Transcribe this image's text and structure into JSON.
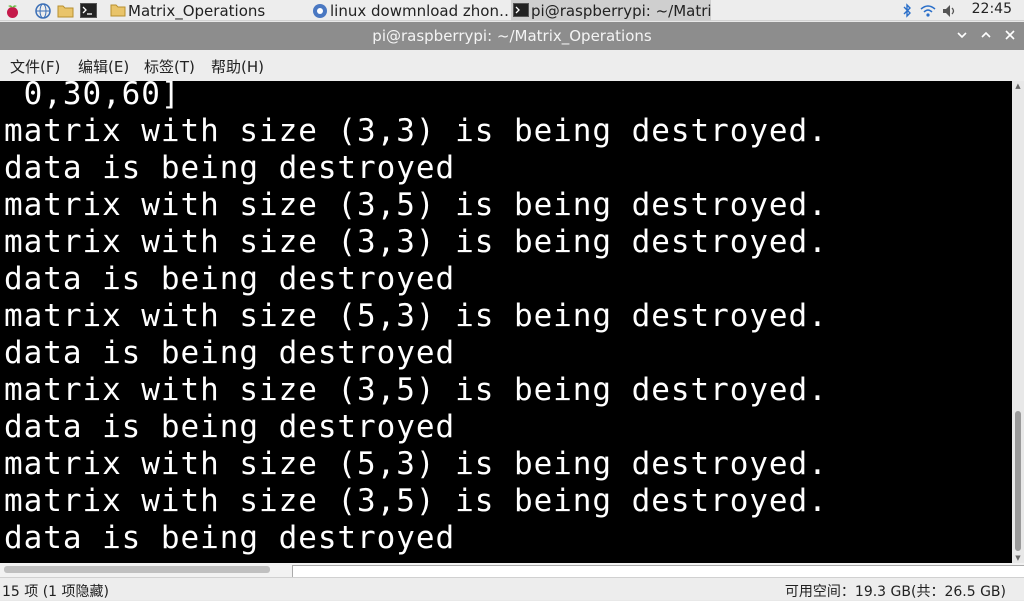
{
  "taskbar": {
    "tasks": [
      {
        "label": "Matrix_Operations",
        "icon": "folder-icon"
      },
      {
        "label": "linux dowmnload zhon…",
        "icon": "chromium-icon"
      },
      {
        "label": "pi@raspberrypi: ~/Matri…",
        "icon": "terminal-icon"
      }
    ],
    "clock": "22:45"
  },
  "window": {
    "title": "pi@raspberrypi: ~/Matrix_Operations"
  },
  "menu": [
    "文件(F)",
    "编辑(E)",
    "标签(T)",
    "帮助(H)"
  ],
  "terminal": {
    "lines": [
      " 0,30,60]",
      "matrix with size (3,3) is being destroyed.",
      "data is being destroyed",
      "matrix with size (3,5) is being destroyed.",
      "matrix with size (3,3) is being destroyed.",
      "data is being destroyed",
      "matrix with size (5,3) is being destroyed.",
      "data is being destroyed",
      "matrix with size (3,5) is being destroyed.",
      "data is being destroyed",
      "matrix with size (5,3) is being destroyed.",
      "matrix with size (3,5) is being destroyed.",
      "data is being destroyed"
    ],
    "background": "#000000",
    "foreground": "#ffffff"
  },
  "statusbar": {
    "left": "15 项 (1 项隐藏)",
    "right": "可用空间：19.3 GB(共：26.5 GB)"
  }
}
